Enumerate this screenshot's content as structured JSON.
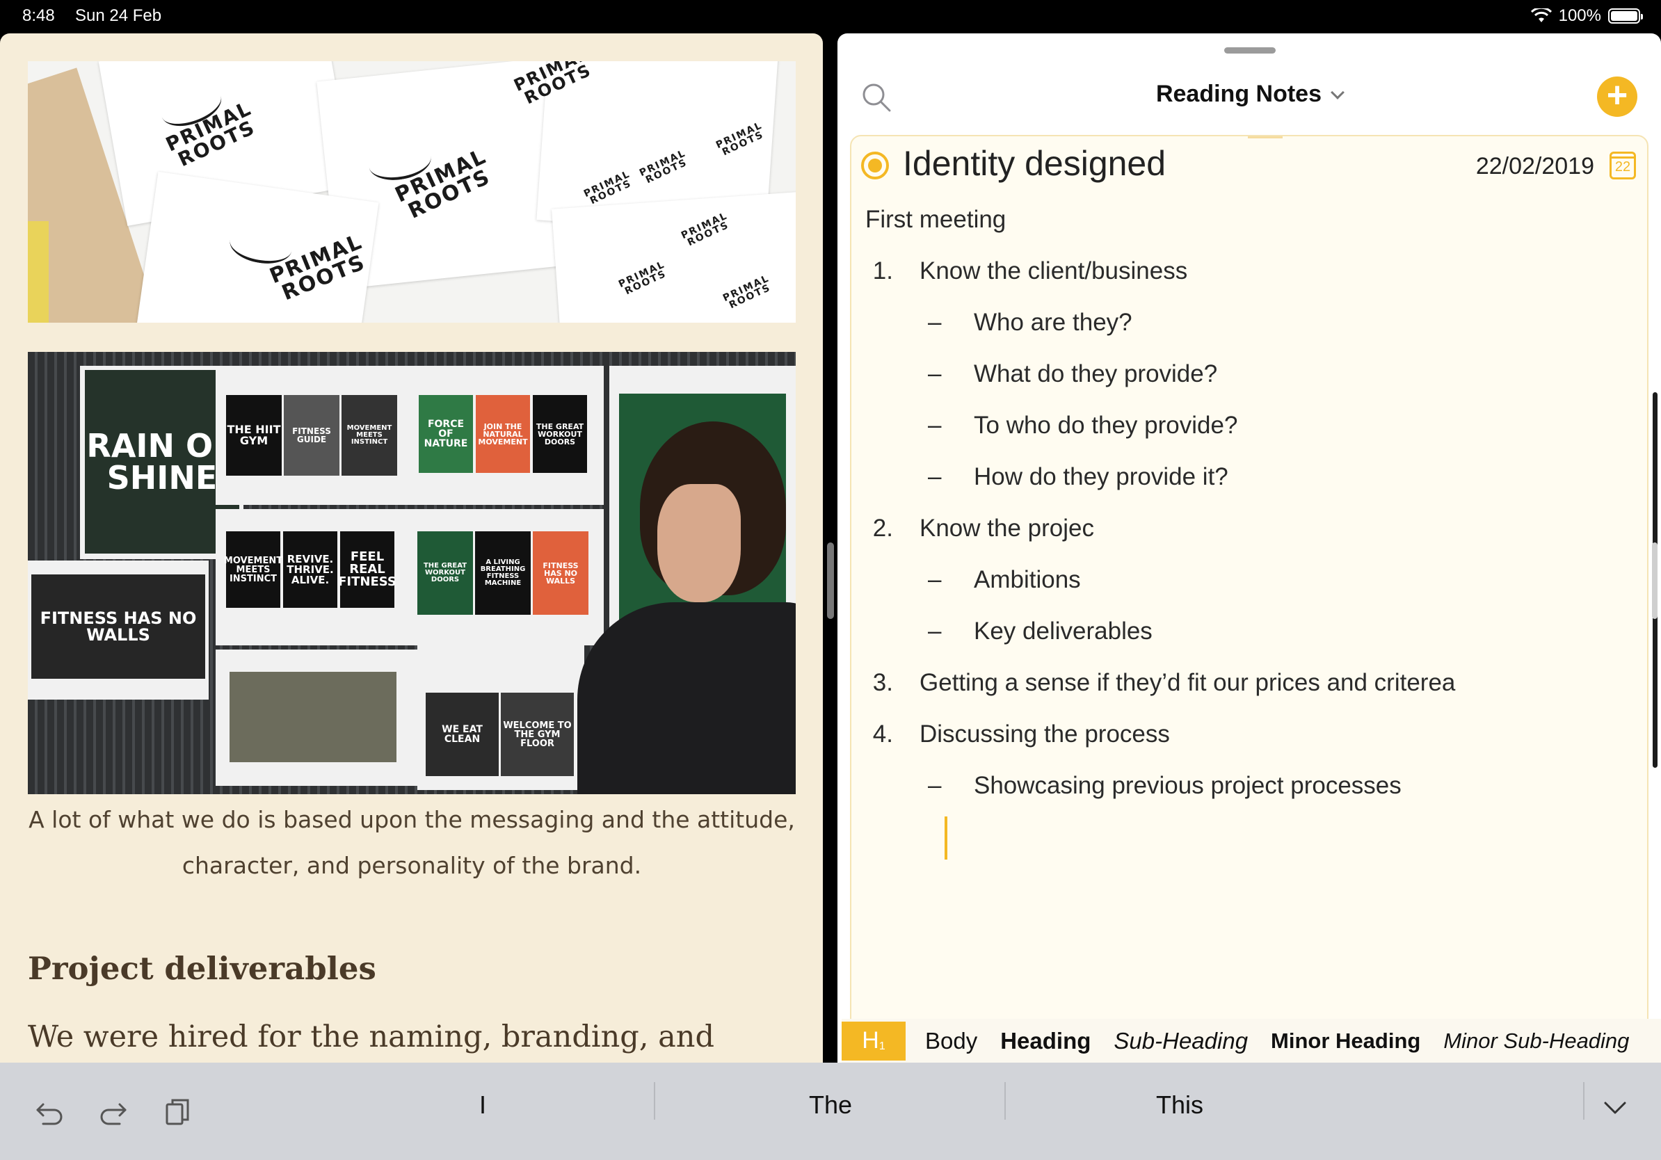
{
  "status_bar": {
    "time": "8:48",
    "date": "Sun 24 Feb",
    "battery": "100%"
  },
  "left_pane": {
    "caption": "A lot of what we do is based upon the messaging and the attitude, character, and personality of the brand.",
    "section_heading": "Project deliverables",
    "body_text": "We were hired for the naming, branding, and positioning, and for providing strategic insight to"
  },
  "photo_text": {
    "brand_logo": "PRIMAL\nROOTS",
    "posters": [
      "RAIN OR SHINE",
      "THE HIIT GYM",
      "FITNESS GUIDE",
      "MOVEMENT MEETS INSTINCT",
      "FORCE OF NATURE",
      "JOIN THE NATURAL MOVEMENT",
      "THE GREAT WORKOUT DOORS",
      "MOVEMENT MEETS INSTINCT",
      "REVIVE. THRIVE. ALIVE.",
      "FEEL REAL FITNESS",
      "THE GREAT WORKOUT DOORS",
      "A LIVING BREATHING FITNESS MACHINE",
      "FITNESS HAS NO WALLS",
      "FITNESS HAS NO WALLS",
      "WE EAT CLEAN",
      "WELCOME TO THE GYM FLOOR"
    ]
  },
  "right_pane": {
    "nav_title": "Reading Notes",
    "note": {
      "title": "Identity designed",
      "date": "22/02/2019",
      "calendar_day": "22",
      "lines": [
        {
          "type": "text",
          "text": "First meeting"
        },
        {
          "type": "numbered",
          "marker": "1.",
          "text": "Know the client/business"
        },
        {
          "type": "bullet",
          "marker": "–",
          "text": "Who are they?"
        },
        {
          "type": "bullet",
          "marker": "–",
          "text": "What do they provide?"
        },
        {
          "type": "bullet",
          "marker": "–",
          "text": "To who do they provide?"
        },
        {
          "type": "bullet",
          "marker": "–",
          "text": "How do they provide it?"
        },
        {
          "type": "numbered",
          "marker": "2.",
          "text": "Know the projec"
        },
        {
          "type": "bullet",
          "marker": "–",
          "text": "Ambitions"
        },
        {
          "type": "bullet",
          "marker": "–",
          "text": "Key deliverables"
        },
        {
          "type": "numbered",
          "marker": "3.",
          "text": "Getting a sense if they’d fit our prices and criterea"
        },
        {
          "type": "numbered",
          "marker": "4.",
          "text": "Discussing the process"
        },
        {
          "type": "bullet",
          "marker": "–",
          "text": "Showcasing  previous project processes"
        }
      ]
    }
  },
  "format_bar": {
    "badge": "H",
    "badge_sub": "1",
    "styles": [
      "Body",
      "Heading",
      "Sub-Heading",
      "Minor Heading",
      "Minor Sub-Heading"
    ]
  },
  "keyboard_bar": {
    "suggestions": [
      "I",
      "The",
      "This"
    ],
    "icons": [
      "undo-icon",
      "redo-icon",
      "paste-icon",
      "dismiss-keyboard-icon"
    ]
  },
  "colors": {
    "accent": "#f4b824",
    "left_bg": "#f6edd9",
    "note_bg": "#fffcf1",
    "keyboard_bg": "#d2d4d9"
  }
}
